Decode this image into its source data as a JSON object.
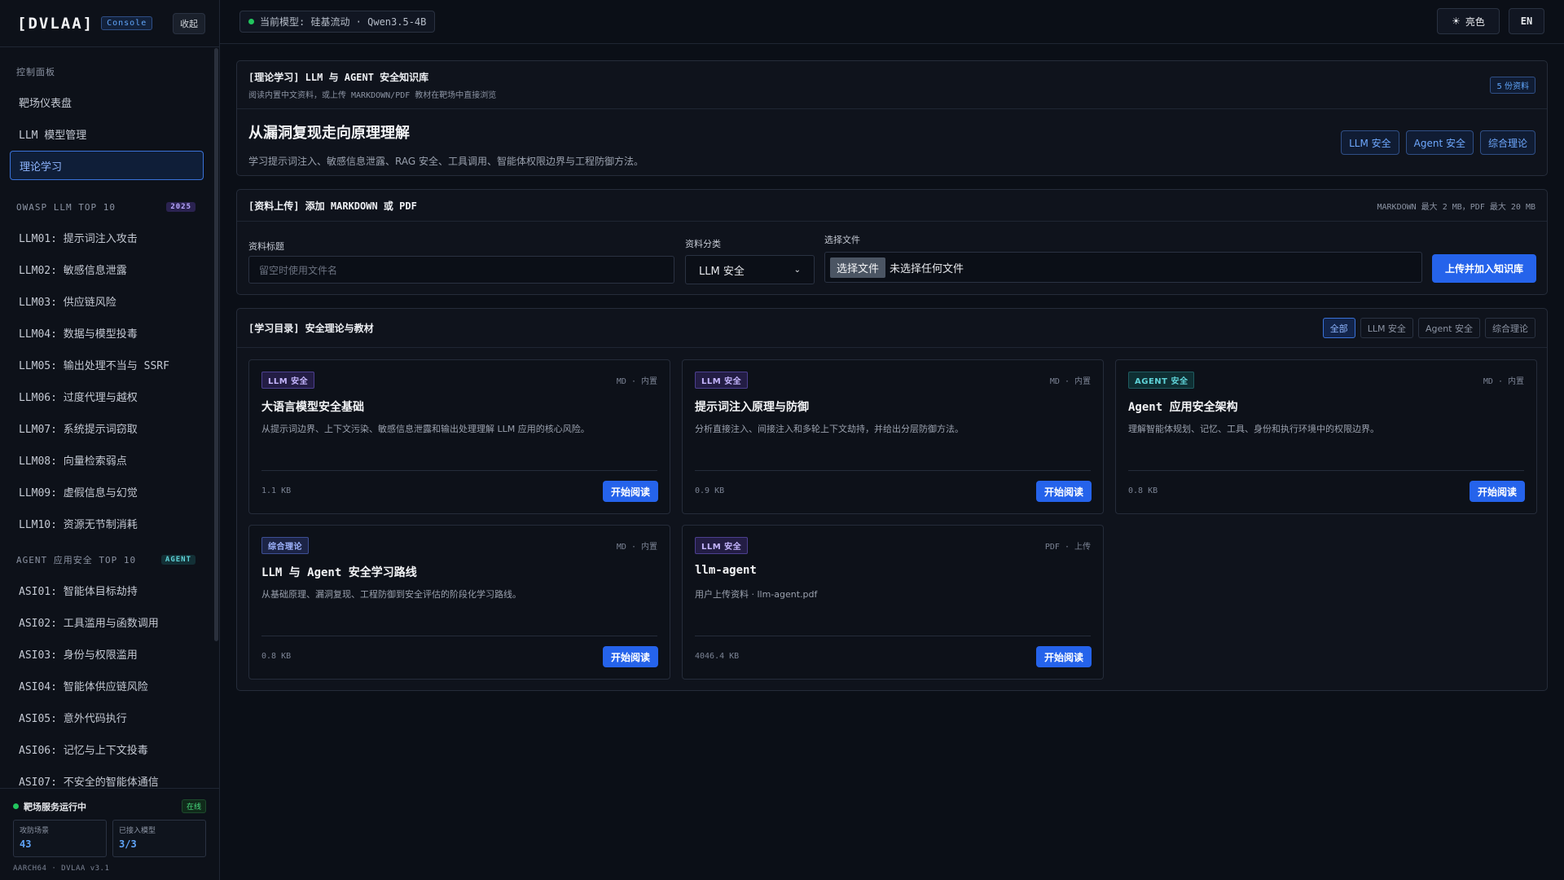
{
  "sidebar": {
    "brand": "[DVLAA]",
    "console_tag": "Console",
    "collapse_label": "收起",
    "sections": {
      "control": "控制面板",
      "owasp": "OWASP LLM TOP 10",
      "owasp_badge": "2025",
      "agent": "AGENT 应用安全 TOP 10",
      "agent_badge": "AGENT"
    },
    "control_items": [
      {
        "label": "靶场仪表盘"
      },
      {
        "label": "LLM 模型管理"
      },
      {
        "label": "理论学习"
      }
    ],
    "llm_items": [
      {
        "label": "LLM01: 提示词注入攻击"
      },
      {
        "label": "LLM02: 敏感信息泄露"
      },
      {
        "label": "LLM03: 供应链风险"
      },
      {
        "label": "LLM04: 数据与模型投毒"
      },
      {
        "label": "LLM05: 输出处理不当与 SSRF"
      },
      {
        "label": "LLM06: 过度代理与越权"
      },
      {
        "label": "LLM07: 系统提示词窃取"
      },
      {
        "label": "LLM08: 向量检索弱点"
      },
      {
        "label": "LLM09: 虚假信息与幻觉"
      },
      {
        "label": "LLM10: 资源无节制消耗"
      }
    ],
    "agent_items": [
      {
        "label": "ASI01: 智能体目标劫持"
      },
      {
        "label": "ASI02: 工具滥用与函数调用"
      },
      {
        "label": "ASI03: 身份与权限滥用"
      },
      {
        "label": "ASI04: 智能体供应链风险"
      },
      {
        "label": "ASI05: 意外代码执行"
      },
      {
        "label": "ASI06: 记忆与上下文投毒"
      },
      {
        "label": "ASI07: 不安全的智能体通信"
      }
    ],
    "footer": {
      "service_title": "靶场服务运行中",
      "service_badge": "在线",
      "stat1_label": "攻防场景",
      "stat1_value": "43",
      "stat2_label": "已接入模型",
      "stat2_value": "3/3",
      "version": "AARCH64 · DVLAA v3.1"
    }
  },
  "topbar": {
    "model_label": "当前模型: 硅基流动 · Qwen3.5-4B",
    "theme_icon": "☀",
    "theme_label": "亮色",
    "lang_label": "EN"
  },
  "intro": {
    "title": "[理论学习] LLM 与 AGENT 安全知识库",
    "subtitle": "阅读内置中文资料，或上传 MARKDOWN/PDF 教材在靶场中直接浏览",
    "count_badge": "5 份资料",
    "hero_title": "从漏洞复现走向原理理解",
    "hero_desc": "学习提示词注入、敏感信息泄露、RAG 安全、工具调用、智能体权限边界与工程防御方法。",
    "tags": [
      "LLM 安全",
      "Agent 安全",
      "综合理论"
    ]
  },
  "upload": {
    "title": "[资料上传] 添加 MARKDOWN 或 PDF",
    "limit": "MARKDOWN 最大 2 MB，PDF 最大 20 MB",
    "title_label": "资料标题",
    "title_placeholder": "留空时使用文件名",
    "category_label": "资料分类",
    "category_value": "LLM 安全",
    "file_label": "选择文件",
    "file_button": "选择文件",
    "file_status": "未选择任何文件",
    "submit_label": "上传并加入知识库"
  },
  "catalog": {
    "title": "[学习目录] 安全理论与教材",
    "filters": [
      "全部",
      "LLM 安全",
      "Agent 安全",
      "综合理论"
    ],
    "read_label": "开始阅读",
    "cards": [
      {
        "category": "LLM 安全",
        "meta": "MD · 内置",
        "title": "大语言模型安全基础",
        "desc": "从提示词边界、上下文污染、敏感信息泄露和输出处理理解 LLM 应用的核心风险。",
        "size": "1.1 KB"
      },
      {
        "category": "LLM 安全",
        "meta": "MD · 内置",
        "title": "提示词注入原理与防御",
        "desc": "分析直接注入、间接注入和多轮上下文劫持，并给出分层防御方法。",
        "size": "0.9 KB"
      },
      {
        "category": "AGENT 安全",
        "meta": "MD · 内置",
        "title": "Agent 应用安全架构",
        "desc": "理解智能体规划、记忆、工具、身份和执行环境中的权限边界。",
        "size": "0.8 KB"
      },
      {
        "category": "综合理论",
        "meta": "MD · 内置",
        "title": "LLM 与 Agent 安全学习路线",
        "desc": "从基础原理、漏洞复现、工程防御到安全评估的阶段化学习路线。",
        "size": "0.8 KB"
      },
      {
        "category": "LLM 安全",
        "meta": "PDF · 上传",
        "title": "llm-agent",
        "desc": "用户上传资料 · llm-agent.pdf",
        "size": "4046.4 KB"
      }
    ]
  },
  "colors": {
    "accent": "#2563eb",
    "status_online": "#22c55e",
    "background": "#0b0f17"
  }
}
